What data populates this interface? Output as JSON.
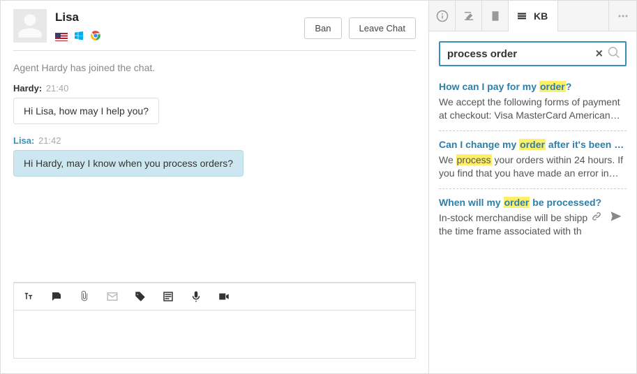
{
  "header": {
    "visitor_name": "Lisa",
    "ban_label": "Ban",
    "leave_label": "Leave Chat"
  },
  "system_message": "Agent Hardy has joined the chat.",
  "messages": [
    {
      "role": "agent",
      "name": "Hardy:",
      "time": "21:40",
      "text": "Hi Lisa, how may I help you?"
    },
    {
      "role": "visitor",
      "name": "Lisa:",
      "time": "21:42",
      "text": "Hi Hardy, may I know when you process orders?"
    }
  ],
  "kb": {
    "tab_label": "KB",
    "search_value": "process order",
    "results": [
      {
        "title_pre": "How can I pay for my ",
        "title_hl": "order",
        "title_post": "?",
        "snippet_pre": "We accept the following forms of payment at checkout: Visa MasterCard American…",
        "snippet_hl": "",
        "snippet_post": ""
      },
      {
        "title_pre": "Can I change my ",
        "title_hl": "order",
        "title_post": " after it's been pla…",
        "snippet_pre": "We ",
        "snippet_hl": "process",
        "snippet_post": " your orders within 24 hours. If you find that you have made an error in…"
      },
      {
        "title_pre": "When will my ",
        "title_hl": "order",
        "title_post": " be processed?",
        "snippet_pre": "In-stock merchandise will be shipped on the time frame associated with th",
        "snippet_hl": "",
        "snippet_post": ""
      }
    ]
  }
}
